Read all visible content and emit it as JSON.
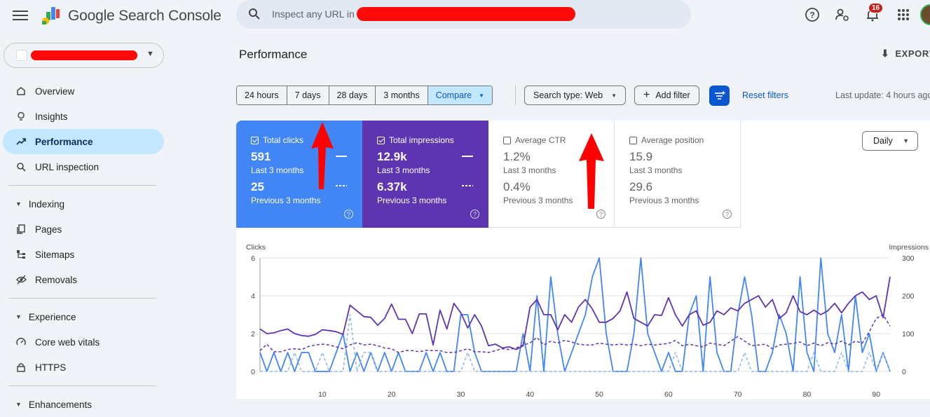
{
  "app": {
    "brand": "Google Search Console"
  },
  "search": {
    "placeholder": "Inspect any URL in"
  },
  "notifications": {
    "count": "16"
  },
  "sidebar": {
    "items": [
      {
        "label": "Overview",
        "icon": "home-icon"
      },
      {
        "label": "Insights",
        "icon": "lightbulb-icon"
      },
      {
        "label": "Performance",
        "icon": "trending-up-icon",
        "active": true
      },
      {
        "label": "URL inspection",
        "icon": "search-icon"
      }
    ],
    "indexing": {
      "title": "Indexing",
      "items": [
        "Pages",
        "Sitemaps",
        "Removals"
      ]
    },
    "experience": {
      "title": "Experience",
      "items": [
        "Core web vitals",
        "HTTPS"
      ]
    },
    "enhancements": {
      "title": "Enhancements"
    }
  },
  "header": {
    "title": "Performance",
    "export": "EXPORT"
  },
  "filters": {
    "ranges": [
      "24 hours",
      "7 days",
      "28 days",
      "3 months",
      "Compare"
    ],
    "selected": "Compare",
    "search_type": "Search type: Web",
    "add_filter": "Add filter",
    "reset": "Reset filters",
    "last_update": "Last update: 4 hours ago"
  },
  "metrics": {
    "clicks": {
      "label": "Total clicks",
      "value": "591",
      "period": "Last 3 months",
      "prev_value": "25",
      "prev_period": "Previous 3 months",
      "checked": true
    },
    "impressions": {
      "label": "Total impressions",
      "value": "12.9k",
      "period": "Last 3 months",
      "prev_value": "6.37k",
      "prev_period": "Previous 3 months",
      "checked": true
    },
    "ctr": {
      "label": "Average CTR",
      "value": "1.2%",
      "period": "Last 3 months",
      "prev_value": "0.4%",
      "prev_period": "Previous 3 months",
      "checked": false
    },
    "position": {
      "label": "Average position",
      "value": "15.9",
      "period": "Last 3 months",
      "prev_value": "29.6",
      "prev_period": "Previous 3 months",
      "checked": false
    }
  },
  "granularity": "Daily",
  "colors": {
    "clicks": "#4285f4",
    "clicks_light": "#8ab4f8",
    "impressions": "#5e35b1",
    "impressions_dash": "#5e35b1"
  },
  "chart_data": {
    "type": "line",
    "ylabel_left": "Clicks",
    "ylabel_right": "Impressions",
    "yleft_ticks": [
      0,
      2,
      4,
      6
    ],
    "yright_ticks": [
      0,
      100,
      200,
      300
    ],
    "xticks": [
      10,
      20,
      30,
      40,
      50,
      60,
      70,
      80,
      90
    ],
    "ylim_left": [
      0,
      6
    ],
    "ylim_right": [
      0,
      300
    ],
    "xlim": [
      1,
      92
    ],
    "series": [
      {
        "name": "Total clicks",
        "axis": "left",
        "style": "solid",
        "color": "#4285f4",
        "values": [
          1,
          0,
          1,
          0,
          1,
          0,
          1,
          1,
          0,
          0,
          0,
          1,
          2,
          0,
          1,
          0,
          1,
          0,
          1,
          0,
          1,
          0,
          0,
          0,
          1,
          0,
          1,
          0,
          0,
          3,
          3,
          1,
          0,
          0,
          0,
          0,
          0,
          0,
          2,
          0,
          4,
          0,
          5,
          2,
          0,
          1,
          2,
          3,
          5,
          6,
          2,
          0,
          0,
          0,
          2,
          6,
          2,
          1,
          0,
          1,
          0,
          0,
          3,
          4,
          0,
          5,
          1,
          0,
          0,
          3,
          5,
          3,
          0,
          0,
          1,
          3,
          2,
          0,
          5,
          1,
          0,
          6,
          2,
          1,
          3,
          0,
          4,
          1,
          2,
          0,
          1,
          0
        ]
      },
      {
        "name": "Total impressions",
        "axis": "right",
        "style": "solid",
        "color": "#5e35b1",
        "values": [
          112,
          100,
          102,
          108,
          112,
          100,
          95,
          93,
          98,
          110,
          108,
          105,
          98,
          175,
          160,
          145,
          143,
          122,
          140,
          178,
          138,
          138,
          100,
          152,
          152,
          70,
          162,
          112,
          180,
          155,
          115,
          150,
          120,
          68,
          72,
          62,
          65,
          58,
          68,
          170,
          190,
          150,
          150,
          110,
          150,
          130,
          170,
          190,
          165,
          130,
          130,
          140,
          160,
          210,
          140,
          130,
          120,
          150,
          148,
          195,
          150,
          120,
          150,
          160,
          122,
          130,
          160,
          150,
          168,
          160,
          180,
          190,
          200,
          170,
          190,
          140,
          155,
          200,
          158,
          150,
          162,
          150,
          160,
          180,
          155,
          180,
          200,
          210,
          190,
          200,
          142,
          250
        ]
      },
      {
        "name": "Total clicks (previous)",
        "axis": "left",
        "style": "dash",
        "color": "#8ab4f8",
        "values": [
          0,
          0,
          0,
          0,
          0,
          1,
          0,
          0,
          0,
          1,
          0,
          0,
          0,
          3,
          0,
          1,
          1,
          0,
          0,
          0,
          0,
          0,
          0,
          0,
          0,
          0,
          0,
          0,
          0,
          0,
          1,
          0,
          0,
          0,
          0,
          0,
          0,
          0,
          0,
          0,
          0,
          0,
          0,
          0,
          0,
          0,
          0,
          0,
          0,
          0,
          0,
          0,
          0,
          0,
          0,
          0,
          0,
          0,
          0,
          0,
          1,
          0,
          0,
          0,
          0,
          0,
          0,
          0,
          0,
          0,
          1,
          0,
          0,
          0,
          0,
          0,
          0,
          0,
          0,
          0,
          1,
          0,
          0,
          0,
          1,
          0,
          0,
          0,
          1,
          0,
          1,
          0
        ]
      },
      {
        "name": "Total impressions (previous)",
        "axis": "right",
        "style": "dash",
        "color": "#5e35b1",
        "values": [
          55,
          72,
          52,
          52,
          58,
          60,
          58,
          66,
          70,
          72,
          70,
          65,
          60,
          70,
          76,
          70,
          72,
          68,
          62,
          60,
          50,
          55,
          55,
          52,
          56,
          55,
          55,
          50,
          50,
          55,
          60,
          52,
          52,
          50,
          55,
          60,
          58,
          62,
          70,
          75,
          90,
          70,
          80,
          75,
          82,
          78,
          72,
          70,
          70,
          75,
          72,
          70,
          72,
          70,
          72,
          68,
          72,
          70,
          72,
          74,
          82,
          68,
          72,
          68,
          65,
          75,
          72,
          68,
          80,
          92,
          80,
          68,
          70,
          72,
          60,
          70,
          72,
          74,
          78,
          68,
          75,
          68,
          76,
          72,
          80,
          70,
          80,
          75,
          105,
          140,
          150,
          120
        ]
      }
    ]
  }
}
